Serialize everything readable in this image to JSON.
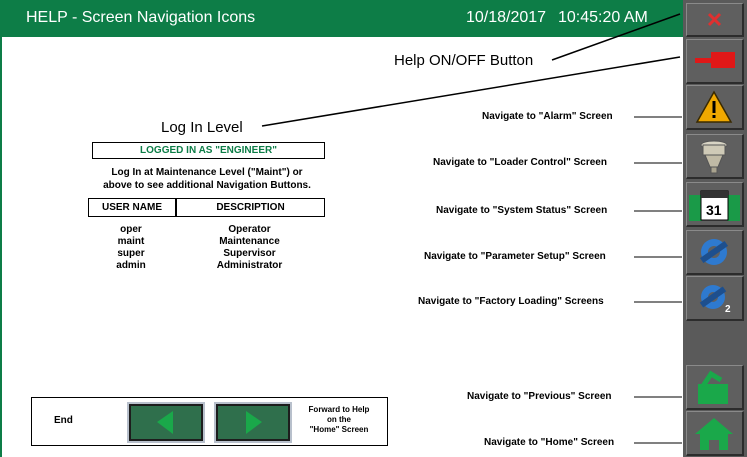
{
  "header": {
    "title": "HELP - Screen Navigation Icons",
    "date": "10/18/2017",
    "time": "10:45:20 AM"
  },
  "callouts": {
    "help_button": "Help ON/OFF Button",
    "login_level": "Log In Level",
    "alarm": "Navigate to \"Alarm\" Screen",
    "loader": "Navigate to \"Loader Control\" Screen",
    "system_status": "Navigate to \"System Status\" Screen",
    "parameter": "Navigate to \"Parameter Setup\" Screen",
    "factory": "Navigate to \"Factory Loading\" Screens",
    "previous": "Navigate to \"Previous\" Screen",
    "home": "Navigate to \"Home\" Screen"
  },
  "login": {
    "status": "LOGGED IN AS \"ENGINEER\"",
    "note_line1": "Log In at Maintenance Level (\"Maint\") or",
    "note_line2": "above to see additional Navigation Buttons.",
    "columns": [
      "USER NAME",
      "DESCRIPTION"
    ],
    "users": [
      {
        "name": "oper",
        "description": "Operator"
      },
      {
        "name": "maint",
        "description": "Maintenance"
      },
      {
        "name": "super",
        "description": "Supervisor"
      },
      {
        "name": "admin",
        "description": "Administrator"
      }
    ]
  },
  "nav_panel": {
    "left_label": "End",
    "right_line1": "Forward to Help",
    "right_line2": "on the",
    "right_line3": "\"Home\" Screen"
  },
  "sidebar_icons": {
    "close": "close-icon",
    "help": "help-icon",
    "alarm": "alarm-icon",
    "loader": "loader-icon",
    "system_status": "system-status-icon",
    "parameter": "parameter-setup-icon",
    "factory": "factory-loading-icon",
    "previous": "previous-screen-icon",
    "home": "home-icon",
    "calendar_day": "31"
  },
  "colors": {
    "title_bar": "#0d7d47",
    "sidebar": "#5a5a5a",
    "login_status": "#0d7d47"
  }
}
